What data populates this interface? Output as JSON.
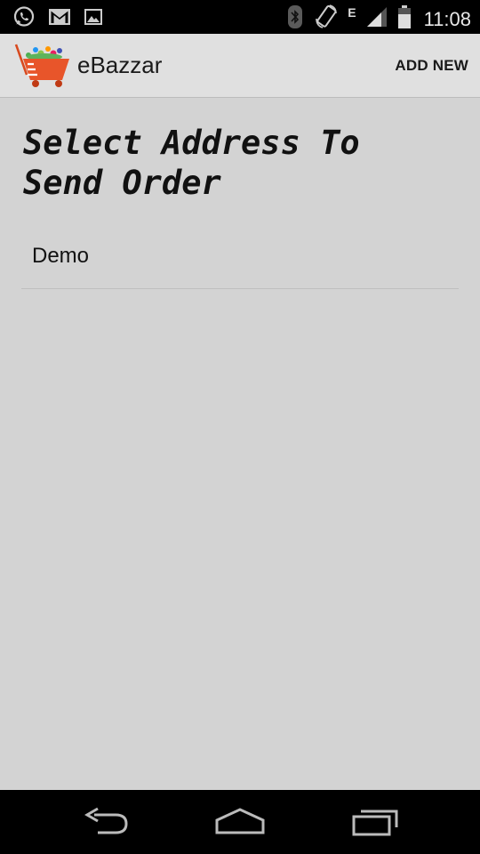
{
  "status_bar": {
    "time": "11:08",
    "network_type": "E",
    "left_icons": [
      "whatsapp-icon",
      "gmail-icon",
      "image-icon"
    ],
    "right_icons": [
      "bluetooth-icon",
      "rotate-icon",
      "signal-icon",
      "battery-icon"
    ]
  },
  "action_bar": {
    "app_name": "eBazzar",
    "add_new_label": "ADD NEW"
  },
  "content": {
    "heading": "Select Address To Send Order",
    "addresses": [
      {
        "name": "Demo"
      }
    ]
  },
  "nav_bar": {
    "buttons": [
      "back-icon",
      "home-icon",
      "recent-apps-icon"
    ]
  },
  "colors": {
    "status_bar_bg": "#000000",
    "action_bar_bg": "#e0e0e0",
    "content_bg": "#d3d3d3",
    "logo_accent": "#e8552a"
  }
}
